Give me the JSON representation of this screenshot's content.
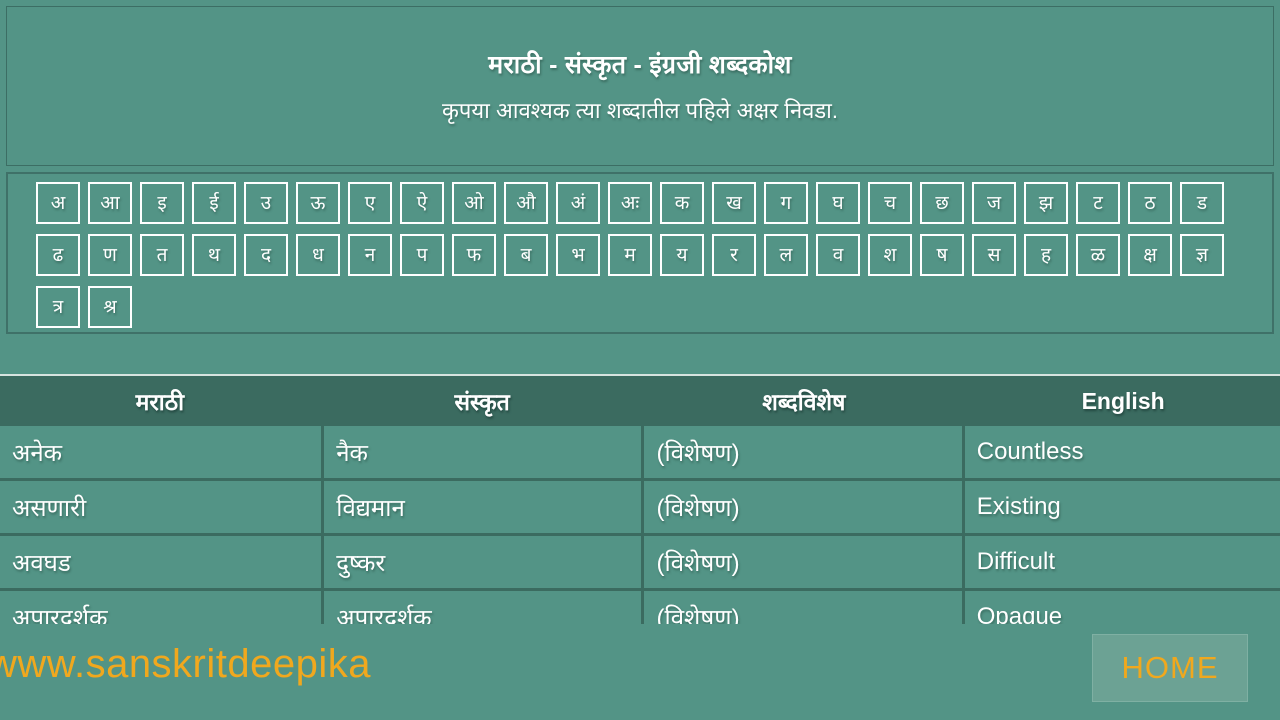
{
  "header": {
    "title": "मराठी - संस्कृत - इंग्रजी शब्दकोश",
    "instruction": "कृपया आवश्यक त्या शब्दातील पहिले अक्षर निवडा."
  },
  "keyboard": {
    "rows": [
      [
        "अ",
        "आ",
        "इ",
        "ई",
        "उ",
        "ऊ",
        "ए",
        "ऐ",
        "ओ",
        "औ",
        "अं",
        "अः",
        "क",
        "ख",
        "ग",
        "घ",
        "च",
        "छ",
        "ज",
        "झ",
        "ट",
        "ठ",
        "ड"
      ],
      [
        "ढ",
        "ण",
        "त",
        "थ",
        "द",
        "ध",
        "न",
        "प",
        "फ",
        "ब",
        "भ",
        "म",
        "य",
        "र",
        "ल",
        "व",
        "श",
        "ष",
        "स",
        "ह",
        "ळ",
        "क्ष",
        "ज्ञ"
      ],
      [
        "त्र",
        "श्र"
      ]
    ]
  },
  "table": {
    "columns": [
      "मराठी",
      "संस्कृत",
      "शब्दविशेष",
      "English"
    ],
    "rows": [
      [
        "अनेक",
        "नैक",
        "(विशेषण)",
        "Countless"
      ],
      [
        "असणारी",
        "विद्यमान",
        "(विशेषण)",
        "Existing"
      ],
      [
        "अवघड",
        "दुष्कर",
        "(विशेषण)",
        "Difficult"
      ],
      [
        "अपारदर्शक",
        "अपारदर्शक",
        "(विशेषण)",
        "Opaque"
      ]
    ]
  },
  "footer": {
    "watermark": "www.sanskritdeepika",
    "home_label": "HOME"
  },
  "colors": {
    "background": "#539486",
    "table_header": "#3b6b60",
    "accent_orange": "#f0a81e",
    "text": "#ffffff"
  }
}
